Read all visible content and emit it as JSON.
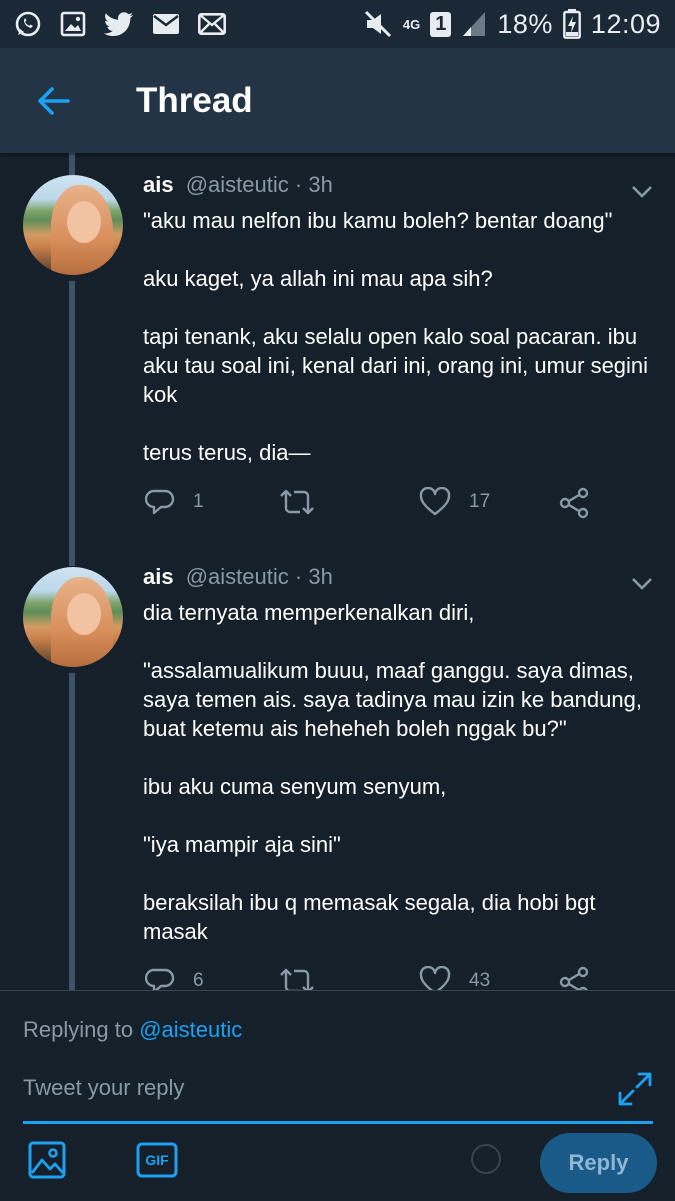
{
  "status_bar": {
    "network": "4G",
    "sim": "1",
    "battery": "18%",
    "time": "12:09",
    "left_icons": [
      "whatsapp-icon",
      "gallery-icon",
      "twitter-icon",
      "mail-icon",
      "mail-icon"
    ]
  },
  "header": {
    "title": "Thread"
  },
  "tweets": [
    {
      "name": "ais",
      "handle": "@aisteutic",
      "time": "· 3h",
      "paragraphs": [
        "\"aku mau nelfon ibu kamu boleh? bentar doang\"",
        "aku kaget, ya allah ini mau apa sih?",
        "tapi tenank, aku selalu open kalo soal pacaran. ibu aku tau soal ini, kenal dari ini, orang ini, umur segini kok",
        "terus terus, dia—"
      ],
      "replies": "1",
      "retweets": "",
      "likes": "17"
    },
    {
      "name": "ais",
      "handle": "@aisteutic",
      "time": "· 3h",
      "paragraphs": [
        "dia ternyata memperkenalkan diri,",
        "\"assalamualikum buuu, maaf ganggu. saya dimas, saya temen ais. saya tadinya mau izin ke bandung, buat ketemu ais heheheh boleh nggak bu?\"",
        "ibu aku cuma senyum senyum,",
        "\"iya mampir aja sini\"",
        "beraksilah ibu q memasak segala, dia hobi bgt masak"
      ],
      "replies": "6",
      "retweets": "",
      "likes": "43"
    }
  ],
  "composer": {
    "replying_prefix": "Replying to",
    "replying_handle": "@aisteutic",
    "placeholder": "Tweet your reply",
    "gif_label": "GIF",
    "reply_label": "Reply"
  },
  "colors": {
    "background": "#15202b",
    "header": "#243447",
    "accent": "#1da1f2",
    "muted": "#8899a6",
    "reply_button": "#1a5a88"
  }
}
